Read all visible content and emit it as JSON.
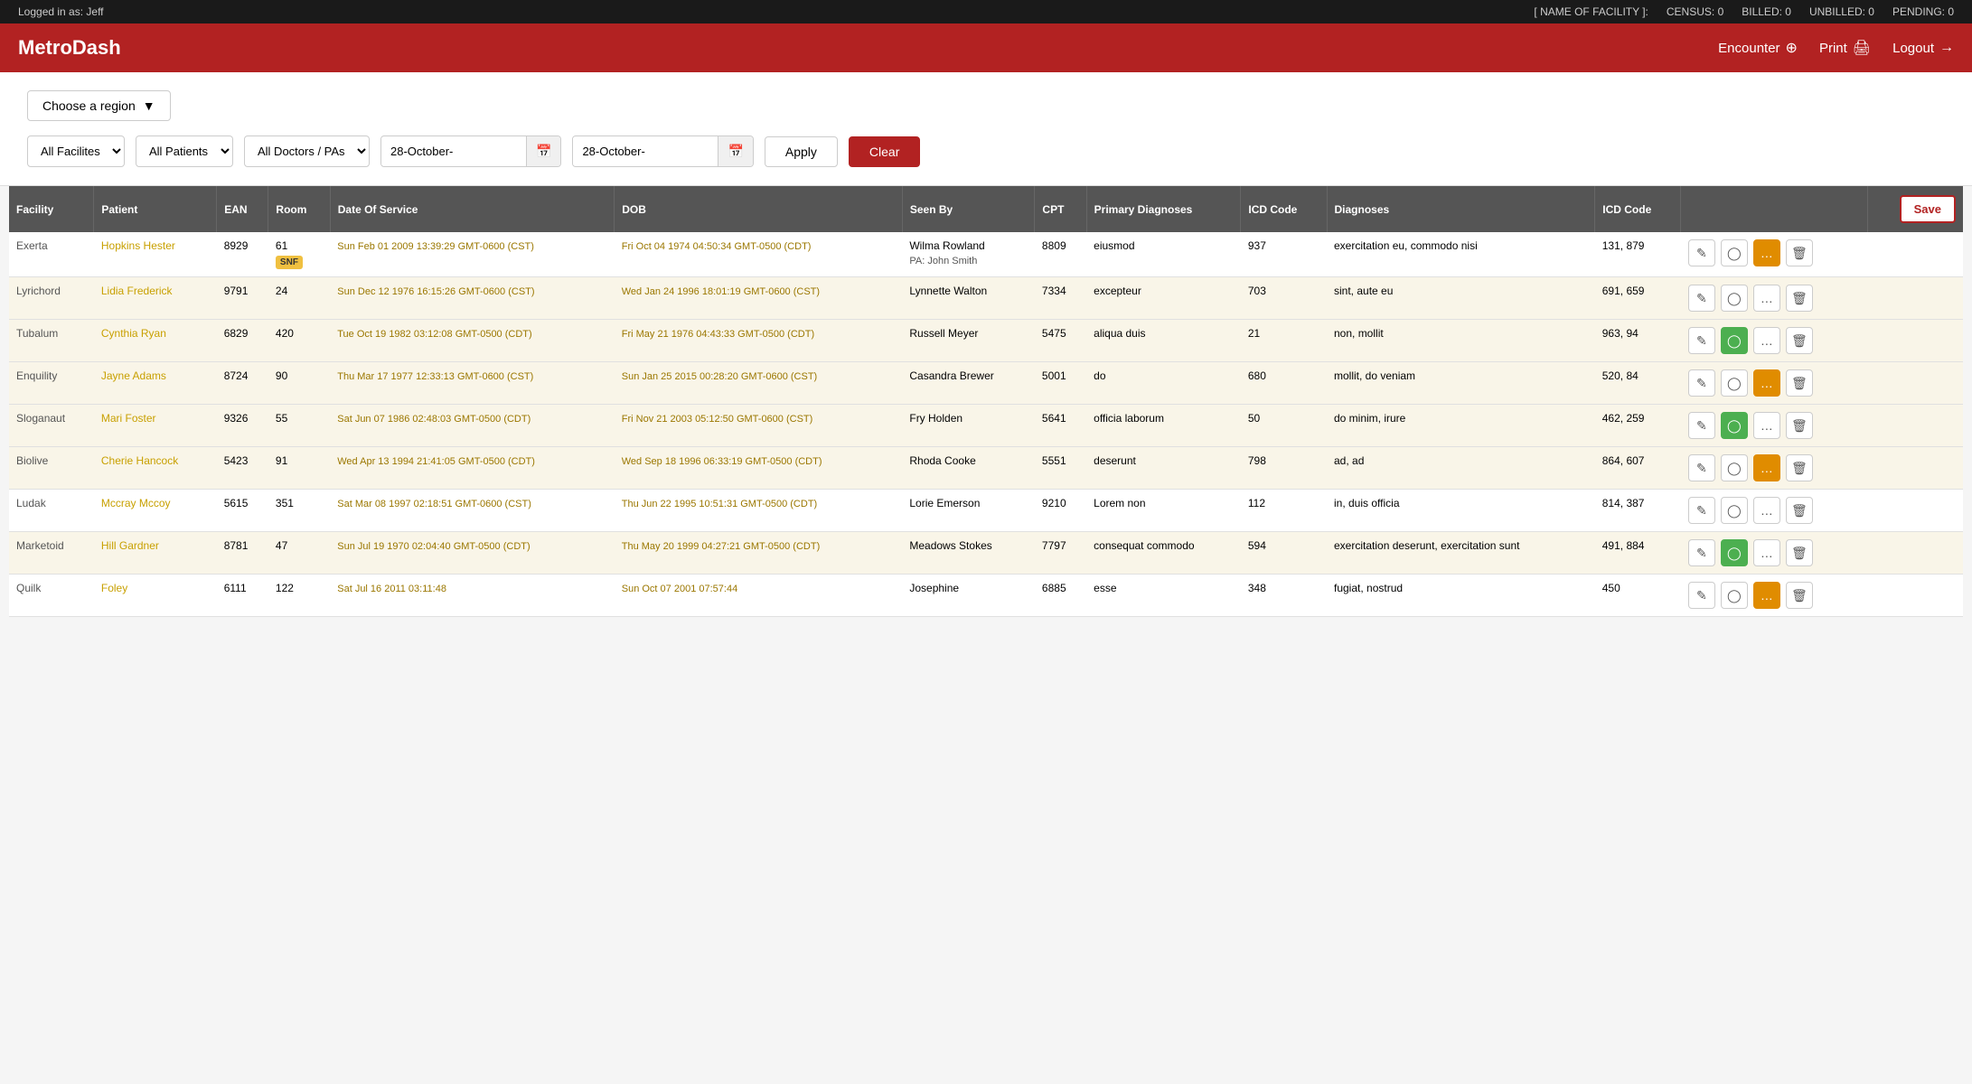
{
  "topbar": {
    "logged_in": "Logged in as: Jeff",
    "facility_label": "[ NAME OF FACILITY ]:",
    "census": "CENSUS: 0",
    "billed": "BILLED: 0",
    "unbilled": "UNBILLED: 0",
    "pending": "PENDING: 0"
  },
  "header": {
    "logo": "MetroDash",
    "encounter_label": "Encounter",
    "print_label": "Print",
    "logout_label": "Logout"
  },
  "filters": {
    "region_btn": "Choose a region",
    "facilities_default": "All Facilites",
    "patients_default": "All Patients",
    "doctors_default": "All Doctors / PAs",
    "date_from": "28-October-",
    "date_to": "28-October-",
    "apply_label": "Apply",
    "clear_label": "Clear"
  },
  "table": {
    "headers": [
      "Facility",
      "Patient",
      "EAN",
      "Room",
      "Date Of Service",
      "DOB",
      "Seen By",
      "CPT",
      "Primary Diagnoses",
      "ICD Code",
      "Diagnoses",
      "ICD Code",
      "",
      "Save"
    ],
    "save_label": "Save",
    "rows": [
      {
        "facility": "Exerta",
        "patient": "Hopkins Hester",
        "ean": "8929",
        "room": "61",
        "room_badge": "SNF",
        "date_of_service": "Sun Feb 01 2009 13:39:29 GMT-0600 (CST)",
        "dob": "Fri Oct 04 1974 04:50:34 GMT-0500 (CDT)",
        "seen_by": "Wilma Rowland",
        "seen_by_pa": "PA: John Smith",
        "cpt": "8809",
        "primary_diagnoses": "eiusmod",
        "icd_code": "937",
        "diagnoses": "exercitation eu, commodo nisi",
        "icd_code2": "131, 879",
        "btn1": "edit",
        "btn2": "circle",
        "btn3": "dots",
        "btn4": "trash",
        "btn2_color": "gray",
        "btn3_color": "orange",
        "row_style": "normal"
      },
      {
        "facility": "Lyrichord",
        "patient": "Lidia Frederick",
        "ean": "9791",
        "room": "24",
        "room_badge": "",
        "date_of_service": "Sun Dec 12 1976 16:15:26 GMT-0600 (CST)",
        "dob": "Wed Jan 24 1996 18:01:19 GMT-0600 (CST)",
        "seen_by": "Lynnette Walton",
        "seen_by_pa": "",
        "cpt": "7334",
        "primary_diagnoses": "excepteur",
        "icd_code": "703",
        "diagnoses": "sint, aute eu",
        "icd_code2": "691, 659",
        "btn2_color": "gray",
        "btn3_color": "gray",
        "row_style": "normal"
      },
      {
        "facility": "Tubalum",
        "patient": "Cynthia Ryan",
        "ean": "6829",
        "room": "420",
        "room_badge": "",
        "date_of_service": "Tue Oct 19 1982 03:12:08 GMT-0500 (CDT)",
        "dob": "Fri May 21 1976 04:43:33 GMT-0500 (CDT)",
        "seen_by": "Russell Meyer",
        "seen_by_pa": "",
        "cpt": "5475",
        "primary_diagnoses": "aliqua duis",
        "icd_code": "21",
        "diagnoses": "non, mollit",
        "icd_code2": "963, 94",
        "btn2_color": "green",
        "btn3_color": "gray",
        "row_style": "highlight"
      },
      {
        "facility": "Enquility",
        "patient": "Jayne Adams",
        "ean": "8724",
        "room": "90",
        "room_badge": "",
        "date_of_service": "Thu Mar 17 1977 12:33:13 GMT-0600 (CST)",
        "dob": "Sun Jan 25 2015 00:28:20 GMT-0600 (CST)",
        "seen_by": "Casandra Brewer",
        "seen_by_pa": "",
        "cpt": "5001",
        "primary_diagnoses": "do",
        "icd_code": "680",
        "diagnoses": "mollit, do veniam",
        "icd_code2": "520, 84",
        "btn2_color": "gray",
        "btn3_color": "orange",
        "row_style": "highlight"
      },
      {
        "facility": "Sloganaut",
        "patient": "Mari Foster",
        "ean": "9326",
        "room": "55",
        "room_badge": "",
        "date_of_service": "Sat Jun 07 1986 02:48:03 GMT-0500 (CDT)",
        "dob": "Fri Nov 21 2003 05:12:50 GMT-0600 (CST)",
        "seen_by": "Fry Holden",
        "seen_by_pa": "",
        "cpt": "5641",
        "primary_diagnoses": "officia laborum",
        "icd_code": "50",
        "diagnoses": "do minim, irure",
        "icd_code2": "462, 259",
        "btn2_color": "green",
        "btn3_color": "gray",
        "row_style": "highlight"
      },
      {
        "facility": "Biolive",
        "patient": "Cherie Hancock",
        "ean": "5423",
        "room": "91",
        "room_badge": "",
        "date_of_service": "Wed Apr 13 1994 21:41:05 GMT-0500 (CDT)",
        "dob": "Wed Sep 18 1996 06:33:19 GMT-0500 (CDT)",
        "seen_by": "Rhoda Cooke",
        "seen_by_pa": "",
        "cpt": "5551",
        "primary_diagnoses": "deserunt",
        "icd_code": "798",
        "diagnoses": "ad, ad",
        "icd_code2": "864, 607",
        "btn2_color": "gray",
        "btn3_color": "orange",
        "row_style": "normal"
      },
      {
        "facility": "Ludak",
        "patient": "Mccray Mccoy",
        "ean": "5615",
        "room": "351",
        "room_badge": "",
        "date_of_service": "Sat Mar 08 1997 02:18:51 GMT-0600 (CST)",
        "dob": "Thu Jun 22 1995 10:51:31 GMT-0500 (CDT)",
        "seen_by": "Lorie Emerson",
        "seen_by_pa": "",
        "cpt": "9210",
        "primary_diagnoses": "Lorem non",
        "icd_code": "112",
        "diagnoses": "in, duis officia",
        "icd_code2": "814, 387",
        "btn2_color": "gray",
        "btn3_color": "gray",
        "row_style": "normal"
      },
      {
        "facility": "Marketoid",
        "patient": "Hill Gardner",
        "ean": "8781",
        "room": "47",
        "room_badge": "",
        "date_of_service": "Sun Jul 19 1970 02:04:40 GMT-0500 (CDT)",
        "dob": "Thu May 20 1999 04:27:21 GMT-0500 (CDT)",
        "seen_by": "Meadows Stokes",
        "seen_by_pa": "",
        "cpt": "7797",
        "primary_diagnoses": "consequat commodo",
        "icd_code": "594",
        "diagnoses": "exercitation deserunt, exercitation sunt",
        "icd_code2": "491, 884",
        "btn2_color": "green",
        "btn3_color": "gray",
        "row_style": "highlight"
      },
      {
        "facility": "Quilk",
        "patient": "Foley",
        "ean": "6111",
        "room": "122",
        "room_badge": "",
        "date_of_service": "Sat Jul 16 2011 03:11:48",
        "dob": "Sun Oct 07 2001 07:57:44",
        "seen_by": "Josephine",
        "seen_by_pa": "",
        "cpt": "6885",
        "primary_diagnoses": "esse",
        "icd_code": "348",
        "diagnoses": "fugiat, nostrud",
        "icd_code2": "450",
        "btn2_color": "gray",
        "btn3_color": "orange",
        "row_style": "normal"
      }
    ]
  }
}
